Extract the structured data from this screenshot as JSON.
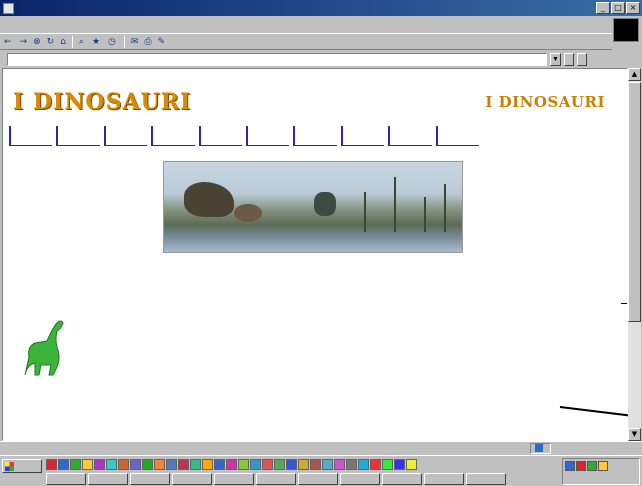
{
  "window": {
    "title": "",
    "controls": {
      "minimize": "_",
      "maximize": "□",
      "close": "×"
    }
  },
  "menubar": {
    "items": [
      "",
      "",
      "",
      "",
      "",
      ""
    ]
  },
  "throbber": {
    "label": ""
  },
  "toolbar": {
    "buttons": [
      {
        "glyph": "←",
        "label": ""
      },
      {
        "glyph": "→",
        "label": ""
      },
      {
        "glyph": "⊗",
        "label": ""
      },
      {
        "glyph": "↻",
        "label": ""
      },
      {
        "glyph": "⌂",
        "label": ""
      },
      {
        "glyph": "⌕",
        "label": ""
      },
      {
        "glyph": "★",
        "label": ""
      },
      {
        "glyph": "◷",
        "label": ""
      },
      {
        "glyph": "✉",
        "label": ""
      },
      {
        "glyph": "⎙",
        "label": ""
      },
      {
        "glyph": "✎",
        "label": ""
      }
    ]
  },
  "addressbar": {
    "label": "",
    "value": "",
    "go": "",
    "links": ""
  },
  "page": {
    "logo_left": "I DINOSAURI",
    "logo_right": "I DINOSAURI",
    "nav": [
      "",
      "",
      "",
      "",
      "",
      "",
      "",
      "",
      "",
      ""
    ],
    "intro_lines": [
      "",
      "",
      "",
      "",
      "",
      "",
      "",
      "",
      "",
      "",
      ""
    ],
    "body_lines": [
      "",
      "",
      "",
      "",
      "",
      "",
      "",
      "",
      "",
      "",
      "",
      "",
      "",
      ""
    ]
  },
  "status": {
    "left": "",
    "zone": ""
  },
  "taskbar": {
    "start": "",
    "tasks": [
      "",
      "",
      "",
      "",
      "",
      "",
      "",
      "",
      "",
      "",
      "",
      "",
      ""
    ],
    "clock": ""
  },
  "colors": {
    "title_bar": "#0a246a",
    "logo": "#d98a00",
    "link": "#1f2fc0",
    "dino_green": "#3cb43c"
  }
}
